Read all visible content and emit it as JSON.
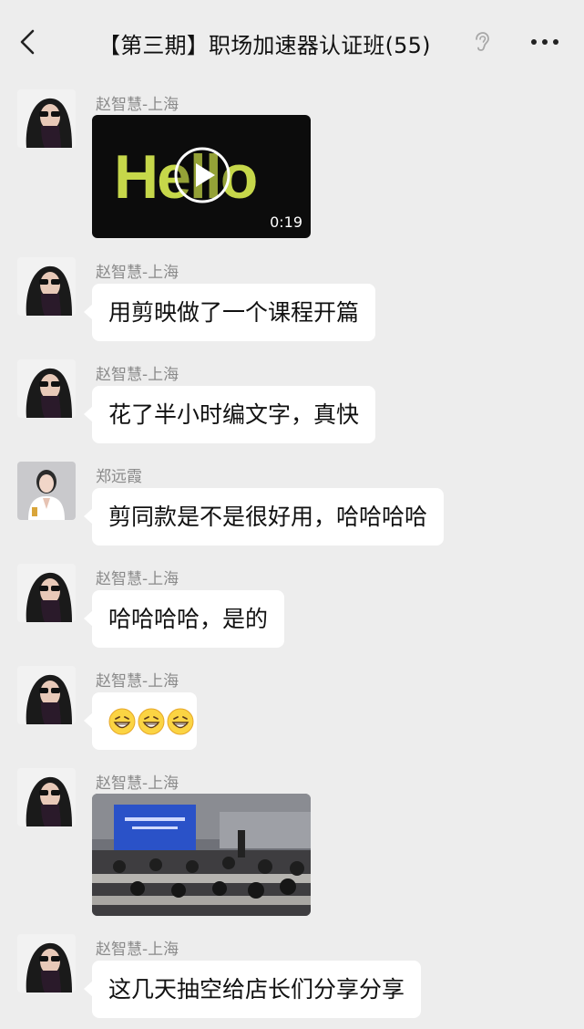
{
  "header": {
    "title": "【第三期】职场加速器认证班(55)",
    "back_icon": "chevron-left-icon",
    "mute_icon": "ear-icon",
    "more_icon": "more-dots-icon"
  },
  "messages": [
    {
      "sender": "赵智慧-上海",
      "type": "video",
      "video_text": "Hello",
      "duration": "0:19"
    },
    {
      "sender": "赵智慧-上海",
      "type": "text",
      "text": "用剪映做了一个课程开篇"
    },
    {
      "sender": "赵智慧-上海",
      "type": "text",
      "text": "花了半小时编文字，真快"
    },
    {
      "sender": "郑远霞",
      "type": "text",
      "text": "剪同款是不是很好用，哈哈哈哈"
    },
    {
      "sender": "赵智慧-上海",
      "type": "text",
      "text": "哈哈哈哈，是的"
    },
    {
      "sender": "赵智慧-上海",
      "type": "text",
      "text": "😁😁😁"
    },
    {
      "sender": "赵智慧-上海",
      "type": "image"
    },
    {
      "sender": "赵智慧-上海",
      "type": "text",
      "text": "这几天抽空给店长们分享分享"
    }
  ],
  "colors": {
    "background": "#ededed",
    "bubble": "#ffffff",
    "video_text": "#c6d74a"
  }
}
